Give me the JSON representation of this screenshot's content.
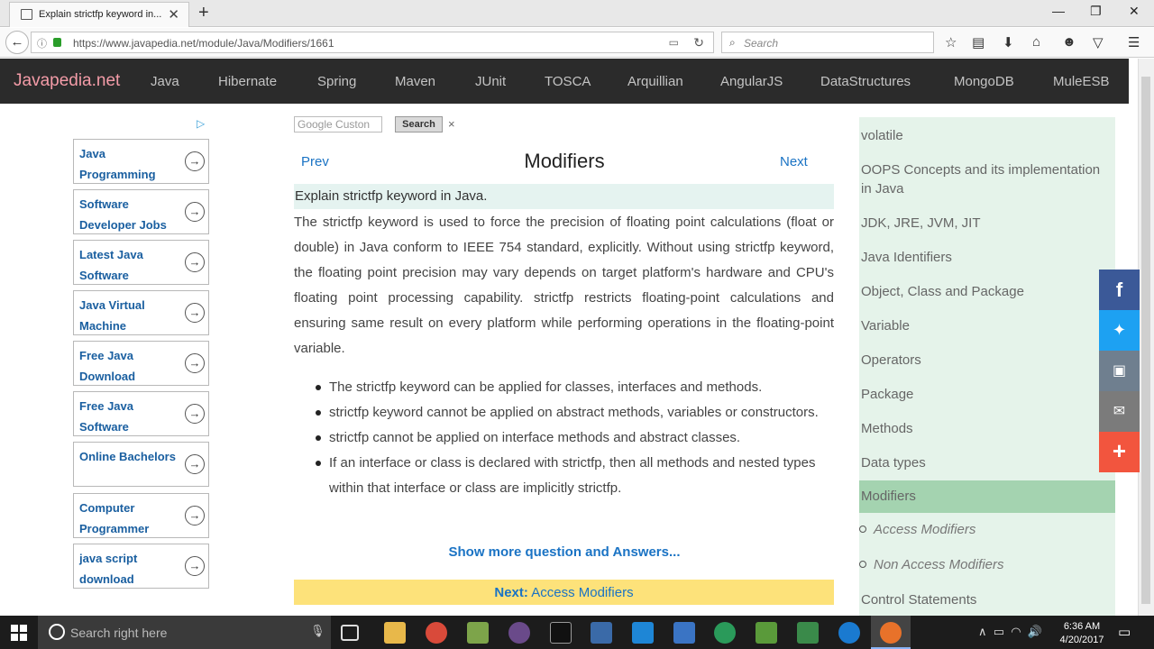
{
  "browser": {
    "tab_title": "Explain strictfp keyword in...",
    "new_tab": "+",
    "url": "https://www.javapedia.net/module/Java/Modifiers/1661",
    "search_placeholder": "Search"
  },
  "site": {
    "brand": "Javapedia.net",
    "nav": [
      "Java",
      "Hibernate",
      "Spring",
      "Maven",
      "JUnit",
      "TOSCA",
      "Arquillian",
      "AngularJS",
      "DataStructures",
      "MongoDB",
      "MuleESB"
    ]
  },
  "ads": {
    "items": [
      "Java Programming",
      "Software Developer Jobs",
      "Latest Java Software",
      "Java Virtual Machine",
      "Free Java Download",
      "Free Java Software",
      "Online Bachelors",
      "Computer Programmer",
      "java script download"
    ]
  },
  "search_widget": {
    "placeholder": "Google  Custon",
    "button": "Search",
    "clear": "×"
  },
  "content": {
    "prev": "Prev",
    "next": "Next",
    "title": "Modifiers",
    "question": "Explain strictfp keyword in Java.",
    "paragraph": "The strictfp keyword is used to force the precision of floating point calculations (float or double) in Java conform to IEEE 754 standard, explicitly. Without using strictfp keyword, the floating point precision may vary depends on target platform's hardware and CPU's floating point processing capability. strictfp restricts floating-point calculations and ensuring same result on every platform while performing operations in the floating-point variable.",
    "bullets": [
      "The strictfp keyword can be applied for classes, interfaces and methods.",
      "strictfp keyword cannot be applied on abstract methods, variables or constructors.",
      "strictfp cannot be applied on interface methods and abstract classes.",
      "If an interface or class is declared with strictfp, then all methods and nested types within that interface or class are implicitly strictfp."
    ],
    "show_more": "Show more question and Answers...",
    "next_label": "Next:",
    "next_link": "Access Modifiers"
  },
  "sidebar": {
    "items": [
      "volatile",
      "OOPS Concepts and its implementation in Java",
      "JDK, JRE, JVM, JIT",
      "Java Identifiers",
      "Object, Class and Package",
      "Variable",
      "Operators",
      "Package",
      "Methods",
      "Data types",
      "Modifiers"
    ],
    "active": "Modifiers",
    "subitems": [
      "Access Modifiers",
      "Non Access Modifiers"
    ],
    "after": "Control Statements"
  },
  "taskbar": {
    "search_placeholder": "Search right here",
    "time": "6:36 AM",
    "date": "4/20/2017"
  },
  "colors": {
    "site_nav_bg": "#2b2b2b",
    "brand": "#f49ca8",
    "link": "#1a73c4",
    "question_bg": "#e5f3f0",
    "sidebar_bg": "#e5f3ea",
    "sidebar_active": "#a4d3b0",
    "next_bar": "#fde27a"
  }
}
